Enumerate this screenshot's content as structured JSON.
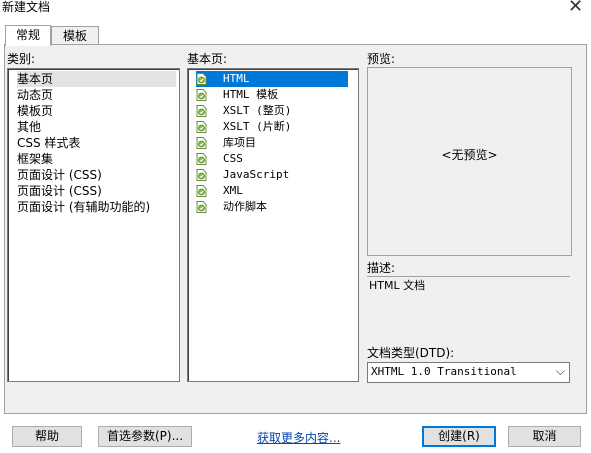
{
  "window": {
    "title": "新建文档",
    "close_glyph": "✕"
  },
  "tabs": [
    {
      "label": "常规"
    },
    {
      "label": "模板"
    }
  ],
  "category": {
    "label": "类别:",
    "items": [
      "基本页",
      "动态页",
      "模板页",
      "其他",
      "CSS 样式表",
      "框架集",
      "页面设计 (CSS)",
      "页面设计 (CSS)",
      "页面设计 (有辅助功能的)"
    ],
    "selected_index": 0
  },
  "basic_page": {
    "label": "基本页:",
    "items": [
      "HTML",
      "HTML 模板",
      "XSLT (整页)",
      "XSLT (片断)",
      "库项目",
      "CSS",
      "JavaScript",
      "XML",
      "动作脚本"
    ],
    "selected_index": 0,
    "item_icon": "document-icon"
  },
  "preview": {
    "label": "预览:",
    "text": "<无预览>"
  },
  "description": {
    "label": "描述:",
    "text": "HTML 文档"
  },
  "doctype": {
    "label": "文档类型(DTD):",
    "value": "XHTML 1.0 Transitional"
  },
  "buttons": {
    "help": "帮助",
    "prefs": "首选参数(P)...",
    "more": "获取更多内容...",
    "create": "创建(R)",
    "cancel": "取消"
  },
  "colors": {
    "selection": "#0078d7",
    "panel": "#f0f0f0",
    "link": "#0645ad"
  }
}
